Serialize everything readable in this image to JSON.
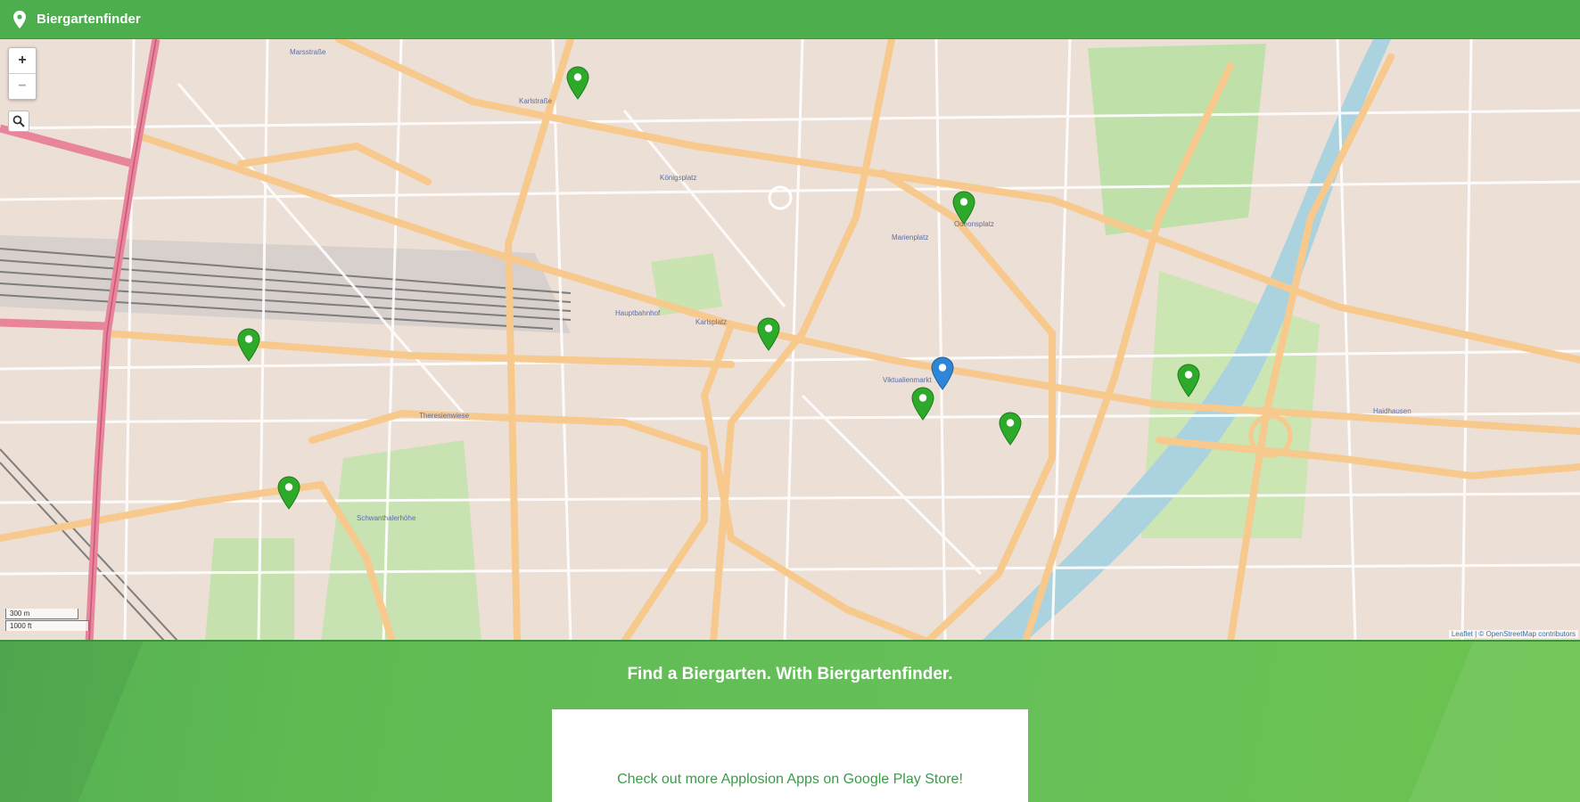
{
  "app": {
    "title": "Biergartenfinder",
    "icon": "map-pin-icon"
  },
  "map": {
    "zoom_in": "+",
    "zoom_out": "−",
    "search_icon": "search-icon",
    "scale_metric": "300 m",
    "scale_imperial": "1000 ft",
    "attribution": "Leaflet | © OpenStreetMap contributors",
    "markers": [
      {
        "type": "biergarten",
        "color": "#2eaa2b"
      },
      {
        "type": "biergarten",
        "color": "#2eaa2b"
      },
      {
        "type": "biergarten",
        "color": "#2eaa2b"
      },
      {
        "type": "biergarten",
        "color": "#2eaa2b"
      },
      {
        "type": "biergarten",
        "color": "#2eaa2b"
      },
      {
        "type": "biergarten",
        "color": "#2eaa2b"
      },
      {
        "type": "biergarten",
        "color": "#2eaa2b"
      },
      {
        "type": "biergarten",
        "color": "#2eaa2b"
      },
      {
        "type": "current-location",
        "color": "#2f86d6"
      }
    ]
  },
  "footer": {
    "tagline": "Find a Biergarten. With Biergartenfinder.",
    "promo_link": "Check out more Applosion Apps on Google Play Store!"
  },
  "colors": {
    "header": "#4cae4c",
    "footer": "#63bd52",
    "marker_green": "#2eaa2b",
    "marker_blue": "#2f86d6"
  }
}
